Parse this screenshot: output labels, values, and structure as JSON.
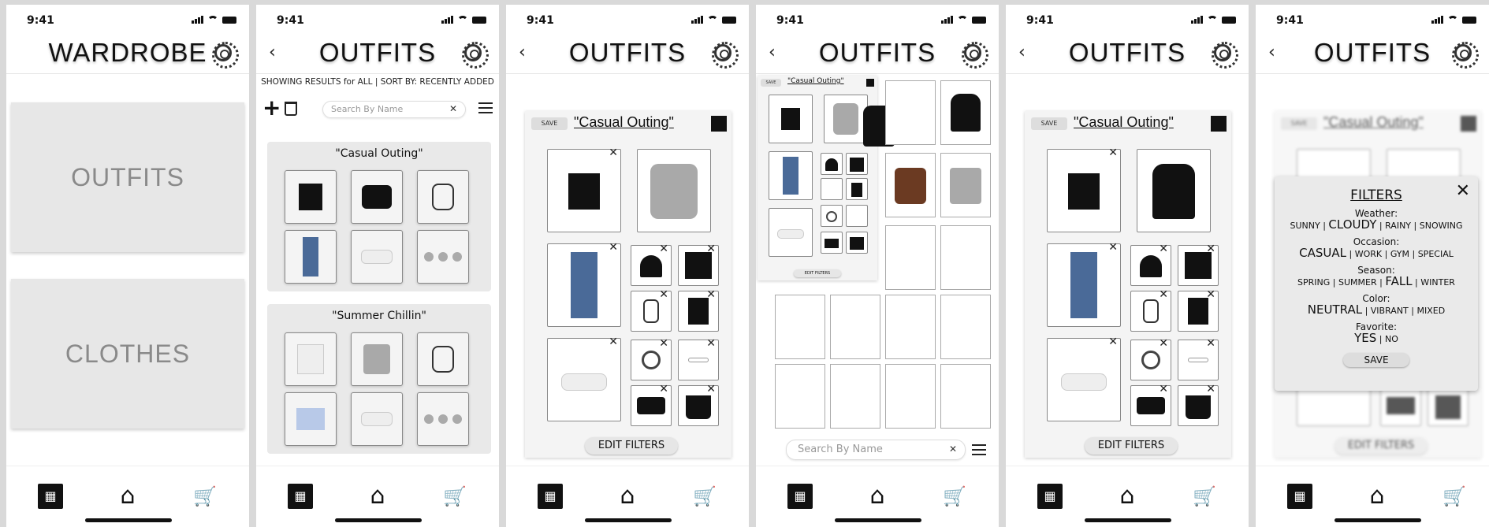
{
  "status": {
    "time": "9:41"
  },
  "screen1": {
    "title": "WARDROBE",
    "cards": [
      "OUTFITS",
      "CLOTHES"
    ]
  },
  "screen2": {
    "title": "OUTFITS",
    "info": "SHOWING RESULTS for ALL | SORT BY: RECENTLY ADDED",
    "search_placeholder": "Search By Name",
    "outfits": [
      {
        "name": "\"Casual Outing\""
      },
      {
        "name": "\"Summer Chillin\""
      }
    ]
  },
  "screen3": {
    "title": "OUTFITS",
    "save": "SAVE",
    "outfit_name": "\"Casual Outing\"",
    "edit_filters": "EDIT FILTERS"
  },
  "screen4": {
    "title": "OUTFITS",
    "save": "SAVE",
    "outfit_name": "\"Casual Outing\"",
    "edit_filters": "EDIT FILTERS",
    "search_placeholder": "Search By Name"
  },
  "screen5": {
    "title": "OUTFITS",
    "save": "SAVE",
    "outfit_name": "\"Casual Outing\"",
    "edit_filters": "EDIT FILTERS"
  },
  "screen6": {
    "title": "OUTFITS",
    "save": "SAVE",
    "outfit_name": "\"Casual Outing\"",
    "edit_filters": "EDIT FILTERS",
    "filters": {
      "heading": "FILTERS",
      "weather_label": "Weather:",
      "weather_opts": [
        "SUNNY",
        "CLOUDY",
        "RAINY",
        "SNOWING"
      ],
      "occasion_label": "Occasion:",
      "occasion_opts": [
        "CASUAL",
        "WORK",
        "GYM",
        "SPECIAL"
      ],
      "season_label": "Season:",
      "season_opts": [
        "SPRING",
        "SUMMER",
        "FALL",
        "WINTER"
      ],
      "color_label": "Color:",
      "color_opts": [
        "NEUTRAL",
        "VIBRANT",
        "MIXED"
      ],
      "favorite_label": "Favorite:",
      "favorite_opts": [
        "YES",
        "NO"
      ],
      "save": "SAVE"
    }
  },
  "icons": {
    "back": "chevron-left-icon",
    "settings": "gear-icon",
    "add": "plus-icon",
    "delete": "trash-icon",
    "clear": "close-icon",
    "filter": "sliders-icon",
    "closet": "closet-icon",
    "home": "home-icon",
    "cart": "cart-heart-icon"
  },
  "colors": {
    "card_bg": "#e7e7e7",
    "selected": "#111111"
  }
}
